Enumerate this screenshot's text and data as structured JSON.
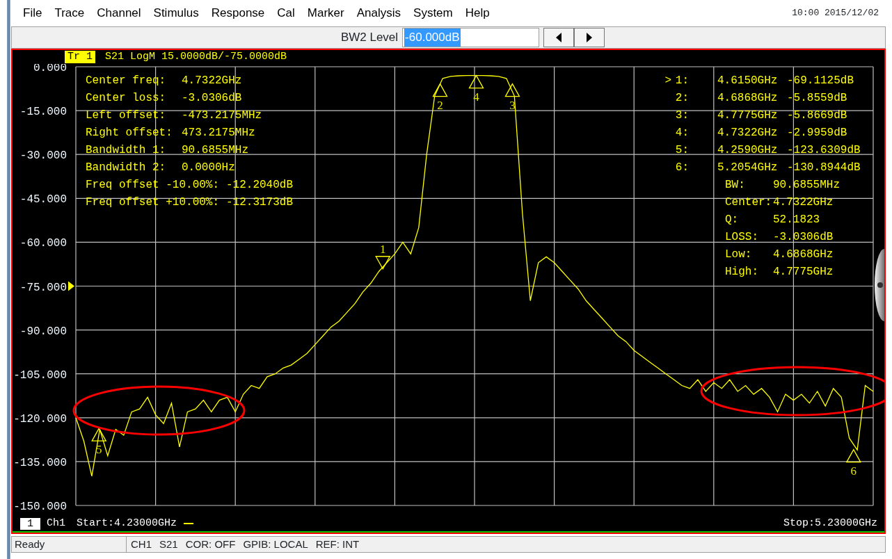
{
  "menu": {
    "items": [
      "File",
      "Trace",
      "Channel",
      "Stimulus",
      "Response",
      "Cal",
      "Marker",
      "Analysis",
      "System",
      "Help"
    ],
    "clock": "10:00 2015/12/02"
  },
  "toolbar": {
    "label": "BW2 Level",
    "value": "-60.000dB",
    "value_selected": true,
    "buttons": [
      {
        "kind": "left"
      },
      {
        "kind": "right"
      }
    ]
  },
  "trace": {
    "tag": "Tr 1",
    "tag_selected": true,
    "description": "S21 LogM 15.0000dB/-75.0000dB"
  },
  "measurements": [
    {
      "label": "Center freq:",
      "value": "4.7322GHz"
    },
    {
      "label": "Center loss:",
      "value": "-3.0306dB"
    },
    {
      "label": "Left offset:",
      "value": "-473.2175MHz"
    },
    {
      "label": "Right offset:",
      "value": "473.2175MHz"
    },
    {
      "label": "Bandwidth 1:",
      "value": "90.6855MHz"
    },
    {
      "label": "Bandwidth 2:",
      "value": "0.0000Hz"
    },
    {
      "label": "Freq offset -10.00%:",
      "value": "-12.2040dB"
    },
    {
      "label": "Freq offset +10.00%:",
      "value": "-12.3173dB"
    }
  ],
  "active_pointer": ">",
  "markers": [
    {
      "label": "1:",
      "flag": "1",
      "frequency": "4.6150GHz",
      "value": "-69.1125dB",
      "selected": true
    },
    {
      "label": "2:",
      "flag": "2",
      "frequency": "4.6868GHz",
      "value": "-5.8559dB",
      "selected": false
    },
    {
      "label": "3:",
      "flag": "3",
      "frequency": "4.7775GHz",
      "value": "-5.8669dB",
      "selected": false
    },
    {
      "label": "4:",
      "flag": "4",
      "frequency": "4.7322GHz",
      "value": "-2.9959dB",
      "selected": false
    },
    {
      "label": "5:",
      "flag": "5",
      "frequency": "4.2590GHz",
      "value": "-123.6309dB",
      "selected": false
    },
    {
      "label": "6:",
      "flag": "6",
      "frequency": "5.2054GHz",
      "value": "-130.8944dB",
      "selected": false
    }
  ],
  "bandwidth_stats": [
    {
      "label": "BW:",
      "value": "90.6855MHz"
    },
    {
      "label": "Center:",
      "value": "4.7322GHz"
    },
    {
      "label": "Q:",
      "value": "52.1823"
    },
    {
      "label": "LOSS:",
      "value": "-3.0306dB"
    },
    {
      "label": "Low:",
      "value": "4.6868GHz"
    },
    {
      "label": "High:",
      "value": "4.7775GHz"
    }
  ],
  "chart_data": {
    "type": "line",
    "ylim": [
      -150,
      0
    ],
    "grid": true,
    "yticks": [
      {
        "value": 0,
        "label": "0.000"
      },
      {
        "value": -15,
        "label": "-15.000"
      },
      {
        "value": -30,
        "label": "-30.000"
      },
      {
        "value": -45,
        "label": "-45.000"
      },
      {
        "value": -60,
        "label": "-60.000"
      },
      {
        "value": -75,
        "label": "-75.000"
      },
      {
        "value": -90,
        "label": "-90.000"
      },
      {
        "value": -105,
        "label": "-105.000"
      },
      {
        "value": -120,
        "label": "-120.000"
      },
      {
        "value": -135,
        "label": "-135.000"
      },
      {
        "value": -150,
        "label": "-150.000"
      }
    ],
    "categories": [
      null,
      null,
      null,
      null,
      null,
      null,
      null,
      null,
      null,
      null,
      null,
      null,
      null,
      null,
      null,
      null,
      null,
      null,
      null,
      null,
      null,
      null,
      null,
      null,
      null,
      null,
      null,
      null,
      null,
      null,
      null,
      null,
      null,
      null,
      null,
      null,
      null,
      null,
      null,
      null,
      null,
      null,
      null,
      null,
      null,
      null,
      null,
      null,
      null,
      null,
      null,
      null,
      null,
      null,
      null,
      null,
      null,
      null,
      null,
      null,
      null,
      null,
      null,
      null,
      null,
      null,
      null,
      null,
      null,
      null,
      null,
      null,
      null,
      null,
      null,
      null,
      null,
      null,
      null,
      null,
      null,
      null,
      null,
      null,
      null,
      null,
      null,
      null,
      null,
      null,
      null,
      null,
      null,
      null,
      null,
      null,
      null,
      null,
      null,
      null,
      null
    ],
    "series": [
      {
        "color": "#ffff00",
        "values": [
          -120,
          -128,
          -140,
          -124,
          -133,
          -124,
          -126,
          -118,
          -117,
          -113,
          -119,
          -122,
          -115,
          -130,
          -118,
          -117,
          -114,
          -118,
          -114,
          -113,
          -118,
          -112,
          -109,
          -110,
          -106,
          -105,
          -103,
          -102,
          -100,
          -98,
          -95,
          -92,
          -89,
          -87,
          -84,
          -81,
          -77,
          -74,
          -70,
          -67,
          -64,
          -60,
          -64,
          -55,
          -30,
          -10,
          -4,
          -3.3,
          -3.1,
          -3,
          -3,
          -3,
          -3.1,
          -3.3,
          -4,
          -10,
          -50,
          -80,
          -67,
          -65,
          -67,
          -70,
          -73,
          -76,
          -80,
          -83,
          -86,
          -89,
          -92,
          -94,
          -97,
          -99,
          -101,
          -103,
          -105,
          -107,
          -109,
          -110,
          -107,
          -111,
          -108,
          -110,
          -107,
          -111,
          -109,
          -112,
          -110,
          -113,
          -118,
          -112,
          -114,
          -112,
          -115,
          -111,
          -116,
          -110,
          -113,
          -127,
          -131,
          -109,
          -111
        ]
      }
    ]
  },
  "channel": {
    "number": "1",
    "name": "Ch1",
    "start": "Start:4.23000GHz",
    "stop": "Stop:5.23000GHz"
  },
  "status_bar": {
    "message": "Ready",
    "fields": [
      "CH1",
      "S21",
      "COR: OFF",
      "GPIB: LOCAL",
      "REF: INT"
    ]
  }
}
